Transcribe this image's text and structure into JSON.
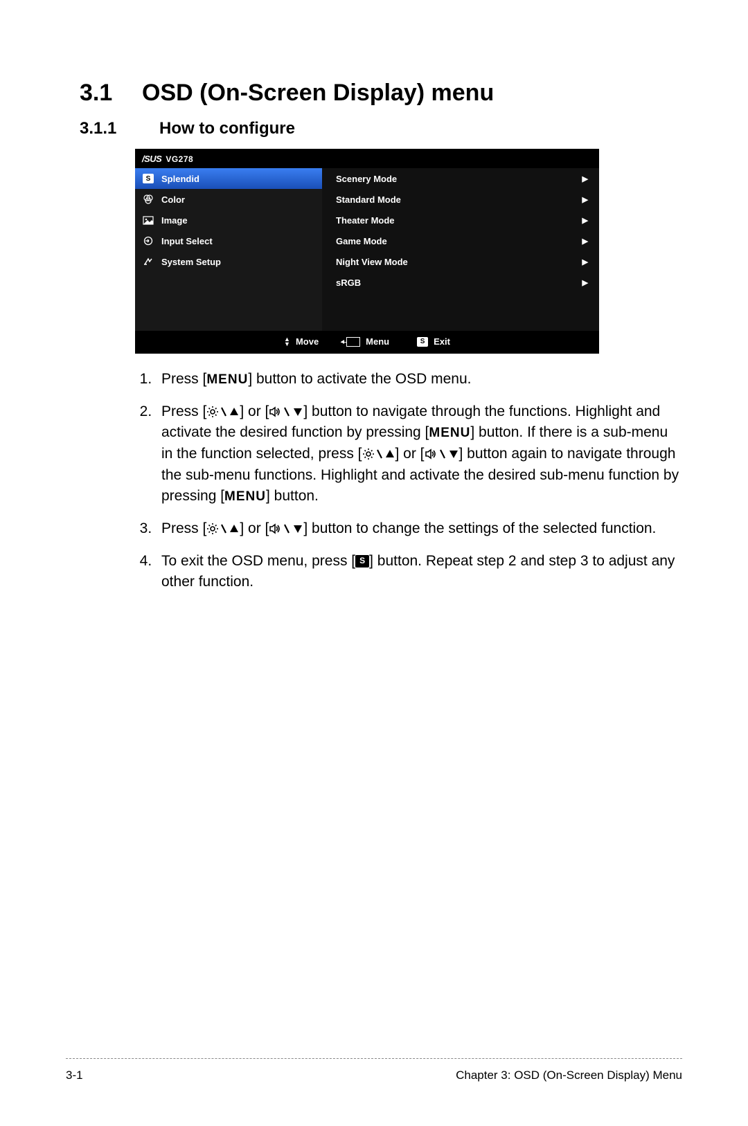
{
  "section": {
    "number": "3.1",
    "title": "OSD (On-Screen Display) menu"
  },
  "subsection": {
    "number": "3.1.1",
    "title": "How to configure"
  },
  "osd": {
    "brand": "/SUS",
    "model": "VG278",
    "left_items": [
      {
        "icon": "s-badge",
        "label": "Splendid",
        "selected": true
      },
      {
        "icon": "color",
        "label": "Color"
      },
      {
        "icon": "image",
        "label": "Image"
      },
      {
        "icon": "input",
        "label": "Input Select"
      },
      {
        "icon": "system",
        "label": "System Setup"
      }
    ],
    "right_items": [
      "Scenery Mode",
      "Standard Mode",
      "Theater Mode",
      "Game Mode",
      "Night View Mode",
      "sRGB"
    ],
    "footer": {
      "move": "Move",
      "menu": "Menu",
      "exit": "Exit"
    }
  },
  "steps": {
    "s1a": "Press [",
    "s1b": "] button to activate the OSD menu.",
    "s2a": "Press [",
    "s2b": "] or [",
    "s2c": "] button to navigate through the functions. Highlight and activate the desired function by pressing [",
    "s2d": "] button. If there is a sub-menu in the function selected, press [",
    "s2e": "] or [",
    "s2f": "] button again to navigate through the sub-menu functions. Highlight and activate the desired sub-menu function by pressing [",
    "s2g": "] button.",
    "s3a": "Press [",
    "s3b": "] or [",
    "s3c": "] button to change the settings of the selected function.",
    "s4a": "To exit the OSD menu, press [",
    "s4b": "] button. Repeat step 2 and step 3 to adjust any other function."
  },
  "footer": {
    "page": "3-1",
    "chapter": "Chapter 3: OSD (On-Screen Display) Menu"
  }
}
